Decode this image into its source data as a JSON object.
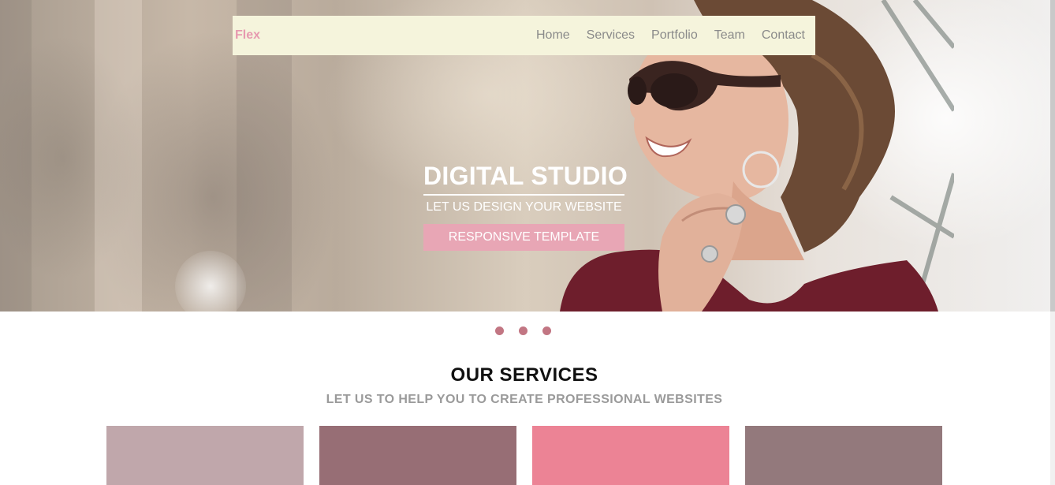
{
  "navbar": {
    "brand": "Flex",
    "links": [
      "Home",
      "Services",
      "Portfolio",
      "Team",
      "Contact"
    ]
  },
  "hero": {
    "title": "DIGITAL STUDIO",
    "subtitle": "LET US DESIGN YOUR WEBSITE",
    "button_label": "RESPONSIVE TEMPLATE"
  },
  "slider": {
    "dot_count": 3
  },
  "services": {
    "title": "OUR SERVICES",
    "subtitle": "LET US TO HELP YOU TO CREATE PROFESSIONAL WEBSITES",
    "card_colors": [
      "#c0a7ab",
      "#976e75",
      "#ec8395",
      "#93797c"
    ]
  },
  "colors": {
    "brand": "#e79ab0",
    "nav_bg": "#f5f4dc",
    "accent_button": "#e8a6b5",
    "dot": "#c27683"
  }
}
